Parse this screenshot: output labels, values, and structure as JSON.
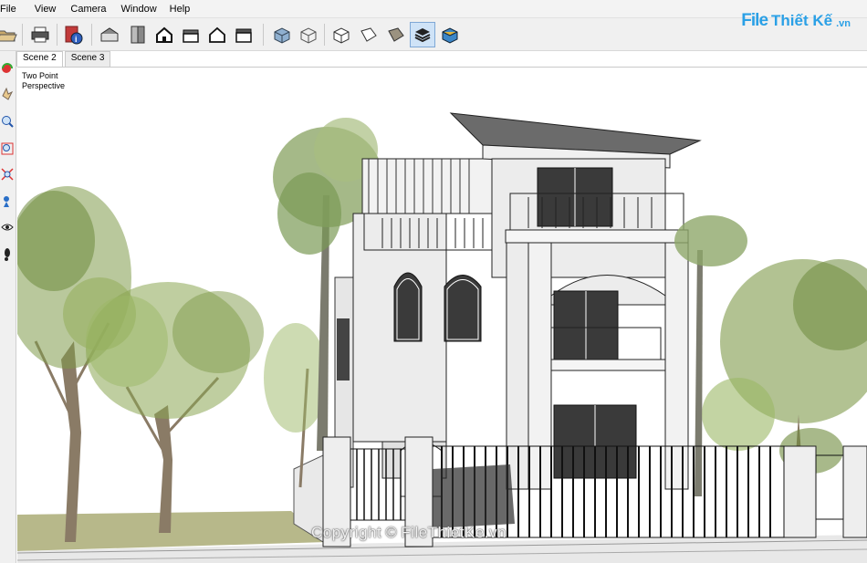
{
  "menu": {
    "items": [
      "File",
      "View",
      "Camera",
      "Window",
      "Help"
    ]
  },
  "toolbar": {
    "buttons": [
      {
        "name": "open-icon"
      },
      {
        "name": "print-icon"
      },
      {
        "name": "model-info-icon"
      },
      {
        "name": "iso-view-icon"
      },
      {
        "name": "top-view-icon"
      },
      {
        "name": "front-view-icon"
      },
      {
        "name": "right-view-icon"
      },
      {
        "name": "back-view-icon"
      },
      {
        "name": "left-view-icon"
      },
      {
        "name": "xray-style-icon"
      },
      {
        "name": "wireframe-style-icon"
      },
      {
        "name": "hidden-line-style-icon"
      },
      {
        "name": "shaded-style-icon"
      },
      {
        "name": "shaded-textures-style-icon"
      },
      {
        "name": "monochrome-style-icon"
      },
      {
        "name": "back-edges-style-icon"
      }
    ],
    "active_button": "shaded-textures-style-icon"
  },
  "logo": {
    "file": "File",
    "rest": "Thiết Kế",
    "suffix": ".vn"
  },
  "tabs": [
    "Scene 2",
    "Scene 3"
  ],
  "selected_tab": "Scene 2",
  "viewport": {
    "label_line1": "Two Point",
    "label_line2": "Perspective",
    "watermark_left": "Copyright",
    "watermark_symbol": "©",
    "watermark_right": "FileThietKe.vn"
  },
  "colors": {
    "logo_blue": "#2aa0e6",
    "active_button_bg": "#cfe3f7",
    "wall": "#ececec",
    "roof": "#6b6b6b",
    "grass": "#b7b88a",
    "trunk": "#8a7b66",
    "foliage": "#7f9a4a",
    "palm": "#8fa86a"
  }
}
